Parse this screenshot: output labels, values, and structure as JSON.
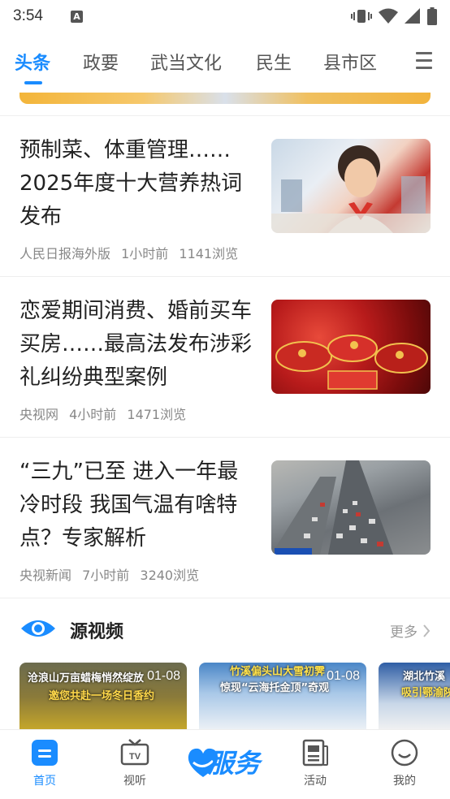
{
  "status_bar": {
    "time": "3:54",
    "notification_letter": "A"
  },
  "tabs": [
    {
      "label": "头条",
      "active": true
    },
    {
      "label": "政要",
      "active": false
    },
    {
      "label": "武当文化",
      "active": false
    },
    {
      "label": "民生",
      "active": false
    },
    {
      "label": "县市区",
      "active": false
    }
  ],
  "news": [
    {
      "title": "预制菜、体重管理……2025年度十大营养热词发布",
      "source": "人民日报海外版",
      "time": "1小时前",
      "views": "1141浏览"
    },
    {
      "title": "恋爱期间消费、婚前买车买房……最高法发布涉彩礼纠纷典型案例",
      "source": "央视网",
      "time": "4小时前",
      "views": "1471浏览"
    },
    {
      "title": "“三九”已至 进入一年最冷时段 我国气温有啥特点？专家解析",
      "source": "央视新闻",
      "time": "7小时前",
      "views": "3240浏览"
    }
  ],
  "video_section": {
    "title": "源视频",
    "more": "更多",
    "videos": [
      {
        "caption": "沧浪山万亩蜡梅悄然绽放",
        "subcaption": "邀您共赴一场冬日香约",
        "date": "01-08"
      },
      {
        "caption": "竹溪偏头山大雪初霁",
        "subcaption": "惊现“云海托金顶”奇观",
        "date": "01-08"
      },
      {
        "caption": "湖北竹溪",
        "subcaption": "吸引鄂渝陕",
        "date": ""
      }
    ]
  },
  "bottom_nav": {
    "home": "首页",
    "video": "视听",
    "service": "服务",
    "activity": "活动",
    "mine": "我的"
  },
  "colors": {
    "accent": "#1a8cff",
    "text": "#222222",
    "meta": "#888888"
  }
}
